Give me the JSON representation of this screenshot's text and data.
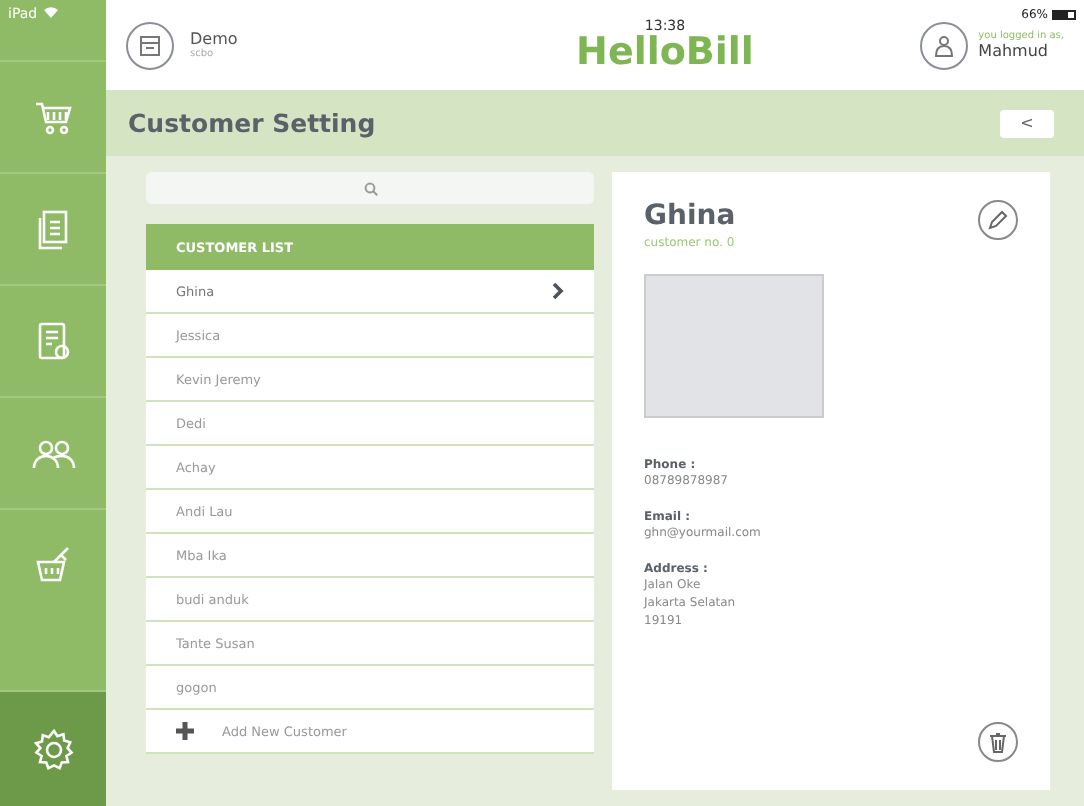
{
  "status_bar": {
    "device": "iPad",
    "time": "13:38",
    "battery": "66%"
  },
  "header": {
    "store_name": "Demo",
    "store_sub": "scbo",
    "app_title": "HelloBill",
    "user_caption": "you logged in as,",
    "user_name": "Mahmud"
  },
  "sidebar": {
    "items": [
      {
        "kind": "cart",
        "selected": false
      },
      {
        "kind": "document",
        "selected": false
      },
      {
        "kind": "receipt",
        "selected": false
      },
      {
        "kind": "people",
        "selected": false
      },
      {
        "kind": "basket",
        "selected": false
      },
      {
        "kind": "settings",
        "selected": true
      }
    ]
  },
  "page": {
    "title": "Customer Setting",
    "back_label": "<"
  },
  "customer_list": {
    "header": "CUSTOMER LIST",
    "items": [
      {
        "name": "Ghina",
        "selected": true
      },
      {
        "name": "Jessica",
        "selected": false
      },
      {
        "name": "Kevin Jeremy",
        "selected": false
      },
      {
        "name": "Dedi",
        "selected": false
      },
      {
        "name": "Achay",
        "selected": false
      },
      {
        "name": "Andi Lau",
        "selected": false
      },
      {
        "name": "Mba Ika",
        "selected": false
      },
      {
        "name": "budi anduk",
        "selected": false
      },
      {
        "name": "Tante Susan",
        "selected": false
      },
      {
        "name": "gogon",
        "selected": false
      }
    ],
    "add_label": "Add New Customer"
  },
  "detail": {
    "name": "Ghina",
    "number": "customer no. 0",
    "fields": [
      {
        "label": "Phone :",
        "lines": [
          "08789878987"
        ]
      },
      {
        "label": "Email :",
        "lines": [
          "ghn@yourmail.com"
        ]
      },
      {
        "label": "Address :",
        "lines": [
          "Jalan Oke",
          "Jakarta Selatan",
          "19191"
        ]
      }
    ]
  }
}
